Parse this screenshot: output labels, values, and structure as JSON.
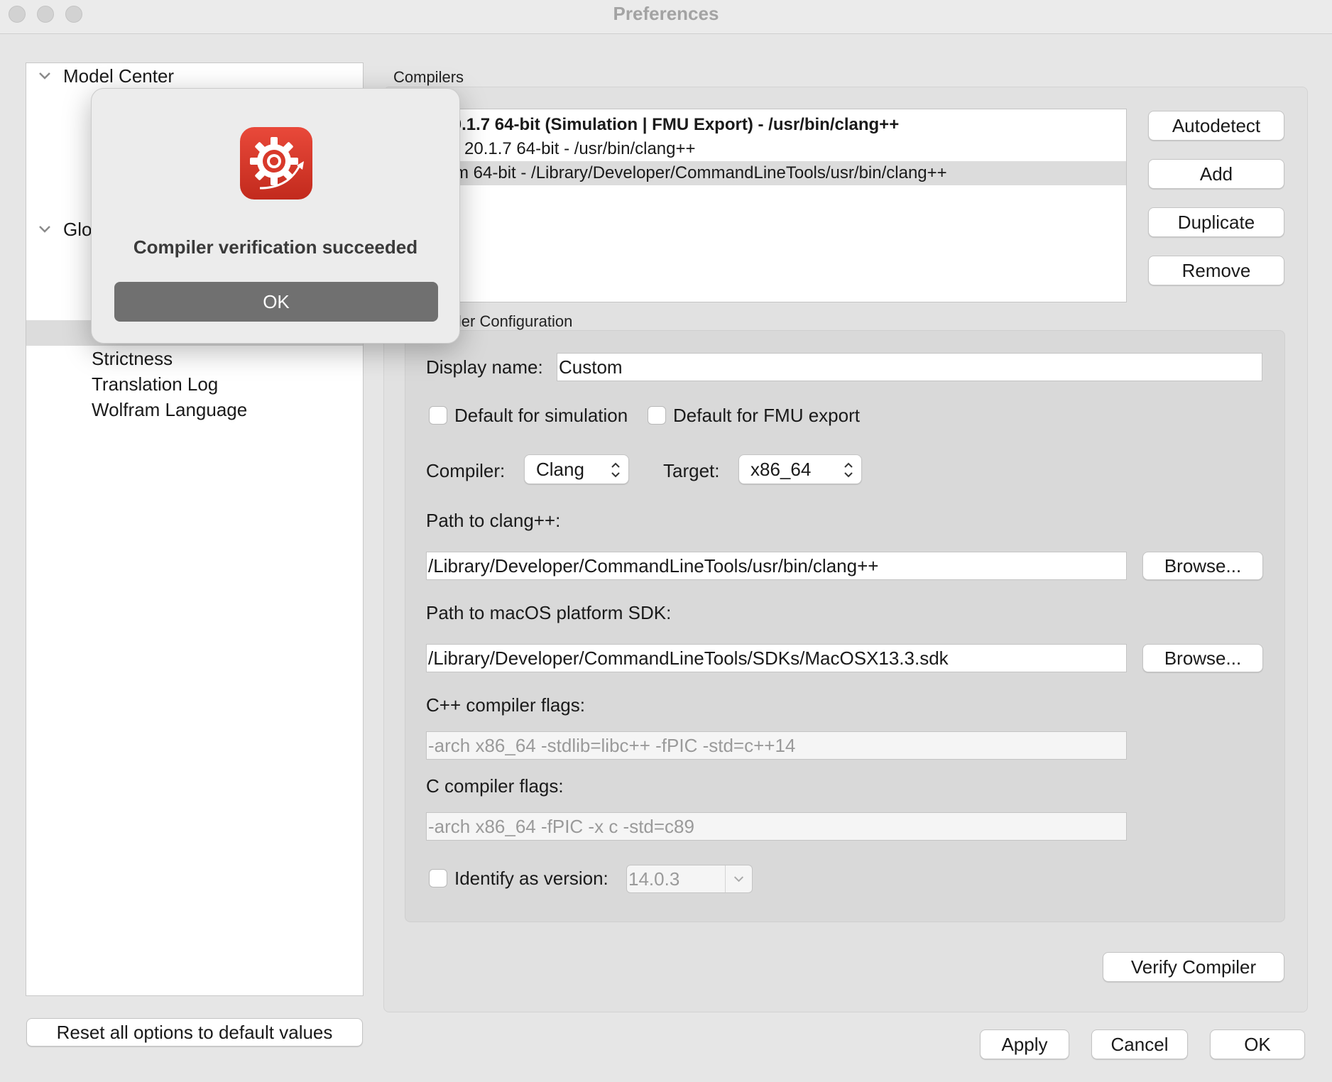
{
  "window": {
    "title": "Preferences"
  },
  "tree": {
    "top": {
      "label": "Model Center"
    },
    "global": {
      "label": "Glo"
    },
    "items": [
      {
        "label": "Strictness"
      },
      {
        "label": "Translation Log"
      },
      {
        "label": "Wolfram Language"
      }
    ]
  },
  "reset_button": "Reset all options to default values",
  "compilers": {
    "group_label": "Compilers",
    "list": [
      {
        "text": "| 20.1.7 64-bit (Simulation | FMU Export) - /usr/bin/clang++"
      },
      {
        "text": "20.1.7 64-bit - /usr/bin/clang++"
      },
      {
        "text": "m 64-bit - /Library/Developer/CommandLineTools/usr/bin/clang++"
      }
    ],
    "buttons": {
      "autodetect": "Autodetect",
      "add": "Add",
      "duplicate": "Duplicate",
      "remove": "Remove"
    }
  },
  "config": {
    "group_label": "iler Configuration",
    "display_name_label": "Display name:",
    "display_name_value": "Custom",
    "default_sim_label": "Default for simulation",
    "default_fmu_label": "Default for FMU export",
    "compiler_label": "Compiler:",
    "compiler_value": "Clang",
    "target_label": "Target:",
    "target_value": "x86_64",
    "path_clang_label": "Path to clang++:",
    "path_clang_value": "/Library/Developer/CommandLineTools/usr/bin/clang++",
    "path_sdk_label": "Path to macOS platform SDK:",
    "path_sdk_value": "/Library/Developer/CommandLineTools/SDKs/MacOSX13.3.sdk",
    "browse_label": "Browse...",
    "cpp_flags_label": "C++ compiler flags:",
    "cpp_flags_placeholder": "-arch x86_64 -stdlib=libc++ -fPIC -std=c++14",
    "c_flags_label": "C compiler flags:",
    "c_flags_placeholder": "-arch x86_64 -fPIC -x c -std=c89",
    "identify_label": "Identify as version:",
    "identify_value": "14.0.3"
  },
  "verify_button": "Verify Compiler",
  "footer": {
    "apply": "Apply",
    "cancel": "Cancel",
    "ok": "OK"
  },
  "dialog": {
    "message": "Compiler verification succeeded",
    "ok": "OK",
    "icon": "gear-app-icon",
    "icon_color": "#d93a2b"
  }
}
